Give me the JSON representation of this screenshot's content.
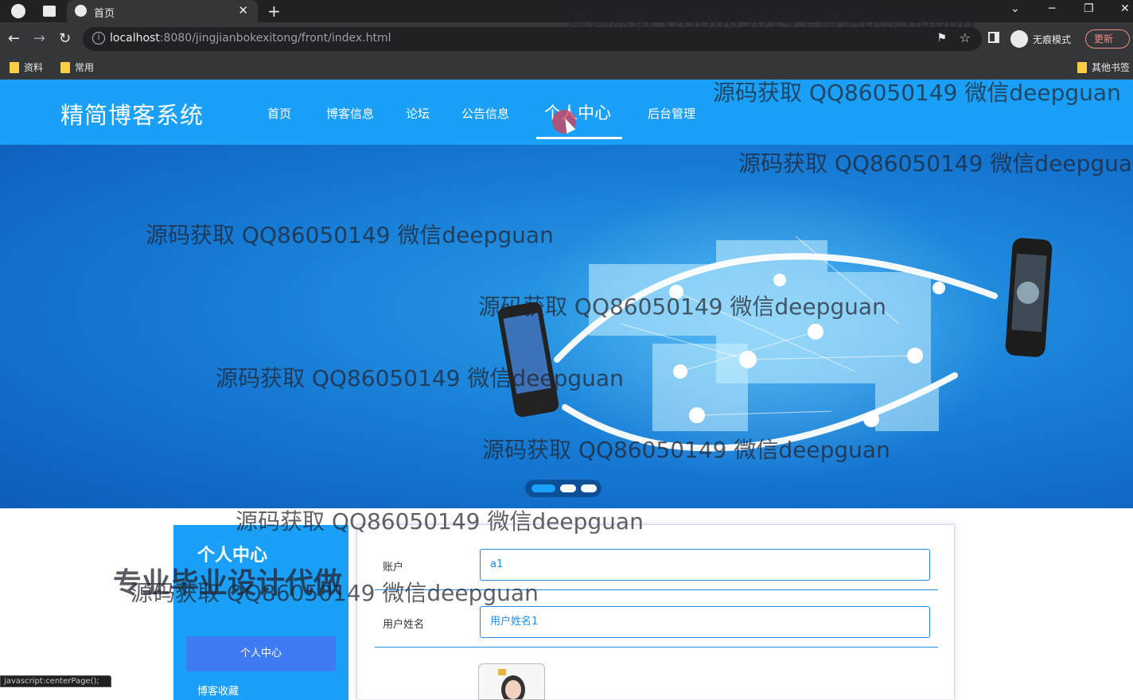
{
  "browser": {
    "tab_title": "首页",
    "url_host": "localhost",
    "url_rest": ":8080/jingjianbokexitong/front/index.html",
    "incognito_label": "无痕模式",
    "update_label": "更新",
    "bookmarks": [
      "资料",
      "常用"
    ],
    "bookmarks_other": "其他书签",
    "status_text": "javascript:centerPage();"
  },
  "site": {
    "logo": "精简博客系统",
    "nav": [
      {
        "label": "首页"
      },
      {
        "label": "博客信息"
      },
      {
        "label": "论坛"
      },
      {
        "label": "公告信息"
      },
      {
        "label": "个人中心",
        "active": true
      },
      {
        "label": "后台管理"
      }
    ]
  },
  "carousel": {
    "slides": 3,
    "active_index": 0
  },
  "sidebar": {
    "title": "个人中心",
    "button_label": "个人中心",
    "next_item": "博客收藏"
  },
  "form": {
    "account_label": "账户",
    "account_value": "a1",
    "username_label": "用户姓名",
    "username_value": "用户姓名1"
  },
  "watermark": {
    "text": "源码获取 QQ86050149 微信deepguan",
    "big_text": "专业毕业设计代做"
  },
  "colors": {
    "header_blue": "#1aa0f8",
    "button_blue": "#3f7cf4",
    "input_border": "#1a8cf0"
  }
}
